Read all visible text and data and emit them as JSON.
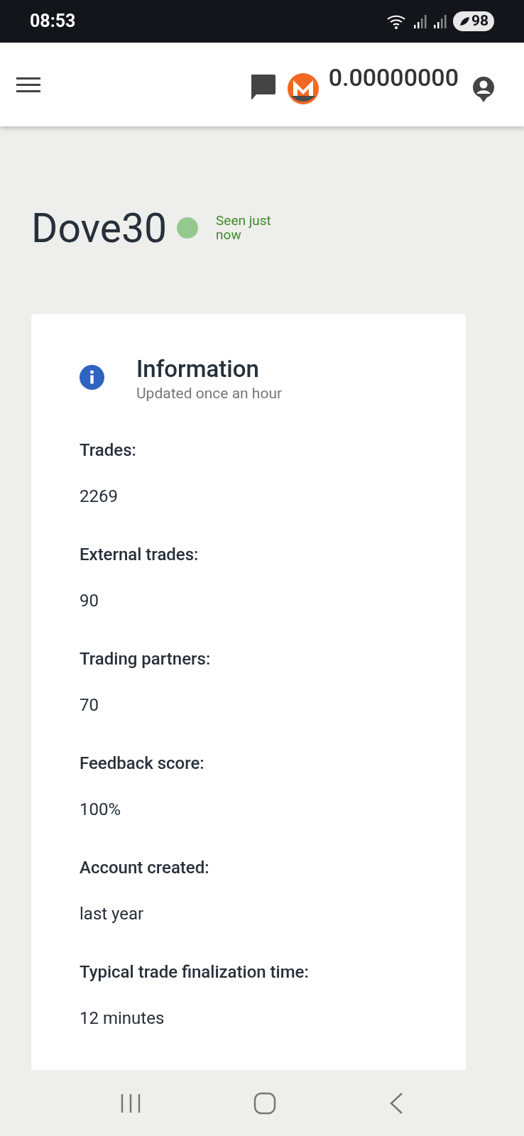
{
  "status_bar": {
    "time": "08:53",
    "battery": "98"
  },
  "header": {
    "balance": "0.00000000"
  },
  "profile": {
    "username": "Dove30",
    "online": true,
    "seen": "Seen just now"
  },
  "card": {
    "title": "Information",
    "subtitle": "Updated once an hour",
    "fields": [
      {
        "label": "Trades:",
        "value": "2269"
      },
      {
        "label": "External trades:",
        "value": "90"
      },
      {
        "label": "Trading partners:",
        "value": "70"
      },
      {
        "label": "Feedback score:",
        "value": "100%"
      },
      {
        "label": "Account created:",
        "value": "last year"
      },
      {
        "label": "Typical trade finalization time:",
        "value": "12 minutes"
      }
    ]
  }
}
